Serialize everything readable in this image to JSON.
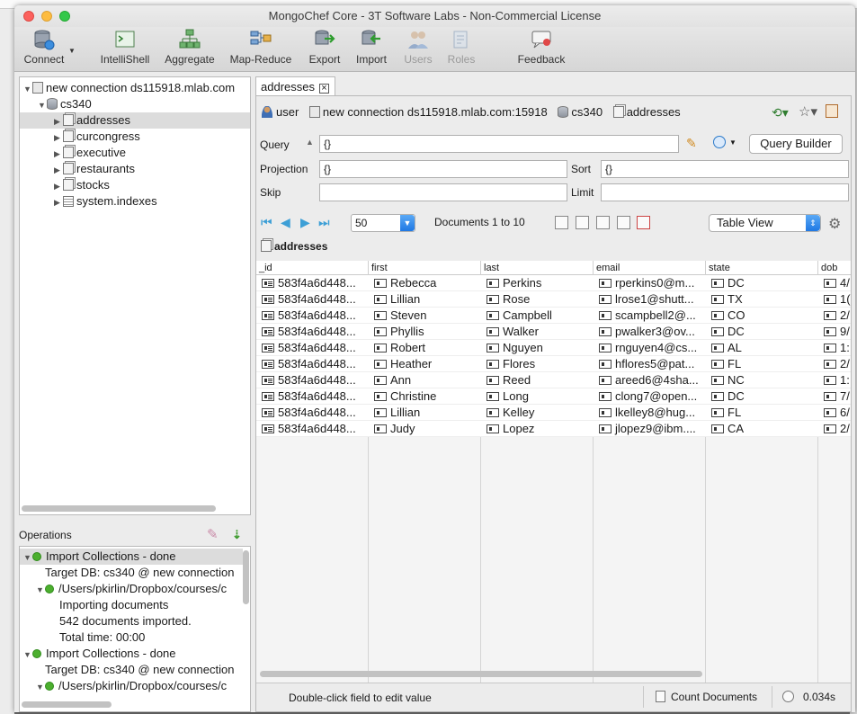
{
  "window": {
    "title": "MongoChef Core - 3T Software Labs - Non-Commercial License"
  },
  "toolbar": [
    {
      "id": "connect",
      "label": "Connect",
      "icon": "connect-icon",
      "disabled": false
    },
    {
      "id": "intellishell",
      "label": "IntelliShell",
      "icon": "intellishell-icon",
      "disabled": false
    },
    {
      "id": "aggregate",
      "label": "Aggregate",
      "icon": "aggregate-icon",
      "disabled": false
    },
    {
      "id": "mapreduce",
      "label": "Map-Reduce",
      "icon": "map-reduce-icon",
      "disabled": false
    },
    {
      "id": "export",
      "label": "Export",
      "icon": "export-icon",
      "disabled": false
    },
    {
      "id": "import",
      "label": "Import",
      "icon": "import-icon",
      "disabled": false
    },
    {
      "id": "users",
      "label": "Users",
      "icon": "users-icon",
      "disabled": true
    },
    {
      "id": "roles",
      "label": "Roles",
      "icon": "roles-icon",
      "disabled": true
    },
    {
      "id": "feedback",
      "label": "Feedback",
      "icon": "feedback-icon",
      "disabled": false
    }
  ],
  "tree": {
    "connection": "new connection ds115918.mlab.com",
    "database": "cs340",
    "collections": [
      "addresses",
      "curcongress",
      "executive",
      "restaurants",
      "stocks",
      "system.indexes"
    ],
    "selected": "addresses"
  },
  "operations": {
    "title": "Operations",
    "rows": [
      {
        "text": "Import Collections -  done",
        "level": 0,
        "tri": "▼",
        "ok": true
      },
      {
        "text": "Target DB: cs340 @ new connection",
        "level": 1,
        "tri": "",
        "ok": false
      },
      {
        "text": "/Users/pkirlin/Dropbox/courses/c",
        "level": 1,
        "tri": "▼",
        "ok": true
      },
      {
        "text": "Importing documents",
        "level": 2,
        "tri": "",
        "ok": false
      },
      {
        "text": "542 documents imported.",
        "level": 2,
        "tri": "",
        "ok": false
      },
      {
        "text": "Total time: 00:00",
        "level": 2,
        "tri": "",
        "ok": false
      },
      {
        "text": "Import Collections -  done",
        "level": 0,
        "tri": "▼",
        "ok": true
      },
      {
        "text": "Target DB: cs340 @ new connection",
        "level": 1,
        "tri": "",
        "ok": false
      },
      {
        "text": "/Users/pkirlin/Dropbox/courses/c",
        "level": 1,
        "tri": "▼",
        "ok": true
      }
    ]
  },
  "tab": {
    "label": "addresses"
  },
  "breadcrumb": {
    "user": "user",
    "connection": "new connection ds115918.mlab.com:15918",
    "database": "cs340",
    "collection": "addresses"
  },
  "query": {
    "query_label": "Query",
    "query_value": "{}",
    "projection_label": "Projection",
    "projection_value": "{}",
    "sort_label": "Sort",
    "sort_value": "{}",
    "skip_label": "Skip",
    "skip_value": "",
    "limit_label": "Limit",
    "limit_value": "",
    "builder_label": "Query Builder"
  },
  "paging": {
    "page_size": "50",
    "docs_label": "Documents 1 to 10",
    "view": "Table View"
  },
  "collection_title": "addresses",
  "table": {
    "columns": [
      "_id",
      "first",
      "last",
      "email",
      "state",
      "dob"
    ],
    "rows": [
      [
        "583f4a6d448...",
        "Rebecca",
        "Perkins",
        "rperkins0@m...",
        "DC",
        "4/"
      ],
      [
        "583f4a6d448...",
        "Lillian",
        "Rose",
        "lrose1@shutt...",
        "TX",
        "1("
      ],
      [
        "583f4a6d448...",
        "Steven",
        "Campbell",
        "scampbell2@...",
        "CO",
        "2/"
      ],
      [
        "583f4a6d448...",
        "Phyllis",
        "Walker",
        "pwalker3@ov...",
        "DC",
        "9/"
      ],
      [
        "583f4a6d448...",
        "Robert",
        "Nguyen",
        "rnguyen4@cs...",
        "AL",
        "1:"
      ],
      [
        "583f4a6d448...",
        "Heather",
        "Flores",
        "hflores5@pat...",
        "FL",
        "2/"
      ],
      [
        "583f4a6d448...",
        "Ann",
        "Reed",
        "areed6@4sha...",
        "NC",
        "1:"
      ],
      [
        "583f4a6d448...",
        "Christine",
        "Long",
        "clong7@open...",
        "DC",
        "7/"
      ],
      [
        "583f4a6d448...",
        "Lillian",
        "Kelley",
        "lkelley8@hug...",
        "FL",
        "6/"
      ],
      [
        "583f4a6d448...",
        "Judy",
        "Lopez",
        "jlopez9@ibm....",
        "CA",
        "2/"
      ]
    ]
  },
  "status": {
    "hint": "Double-click field to edit value",
    "count_docs": "Count Documents",
    "time": "0.034s"
  }
}
